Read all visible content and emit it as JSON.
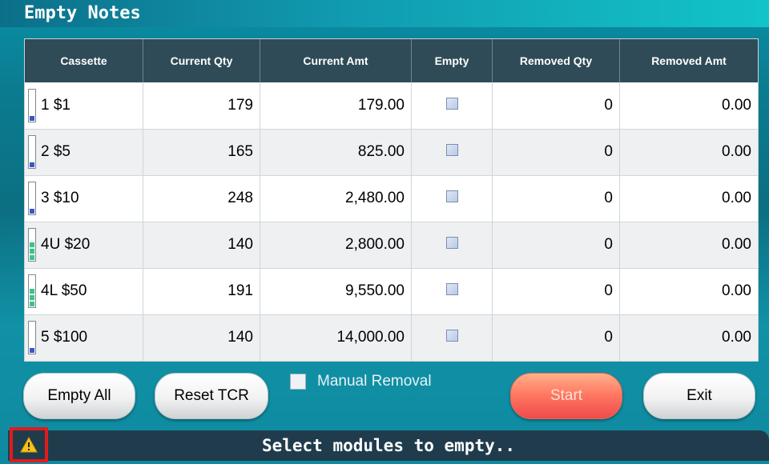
{
  "window": {
    "title": "Empty Notes"
  },
  "table": {
    "headers": [
      "Cassette",
      "Current Qty",
      "Current Amt",
      "Empty",
      "Removed Qty",
      "Removed Amt"
    ],
    "rows": [
      {
        "cassette": "1 $1",
        "current_qty": "179",
        "current_amt": "179.00",
        "removed_qty": "0",
        "removed_amt": "0.00",
        "meter_color": "blue"
      },
      {
        "cassette": "2 $5",
        "current_qty": "165",
        "current_amt": "825.00",
        "removed_qty": "0",
        "removed_amt": "0.00",
        "meter_color": "blue"
      },
      {
        "cassette": "3 $10",
        "current_qty": "248",
        "current_amt": "2,480.00",
        "removed_qty": "0",
        "removed_amt": "0.00",
        "meter_color": "blue"
      },
      {
        "cassette": "4U $20",
        "current_qty": "140",
        "current_amt": "2,800.00",
        "removed_qty": "0",
        "removed_amt": "0.00",
        "meter_color": "green"
      },
      {
        "cassette": "4L $50",
        "current_qty": "191",
        "current_amt": "9,550.00",
        "removed_qty": "0",
        "removed_amt": "0.00",
        "meter_color": "green"
      },
      {
        "cassette": "5 $100",
        "current_qty": "140",
        "current_amt": "14,000.00",
        "removed_qty": "0",
        "removed_amt": "0.00",
        "meter_color": "blue"
      }
    ]
  },
  "buttons": {
    "empty_all": "Empty All",
    "reset_tcr": "Reset TCR",
    "manual_removal": "Manual Removal",
    "start": "Start",
    "exit": "Exit"
  },
  "status": {
    "message": "Select modules to empty..",
    "icon": "warning-icon"
  },
  "colors": {
    "header_bg": "#2f4b58",
    "start_button": "#ff7a63",
    "warning_border": "#e01c1c"
  }
}
